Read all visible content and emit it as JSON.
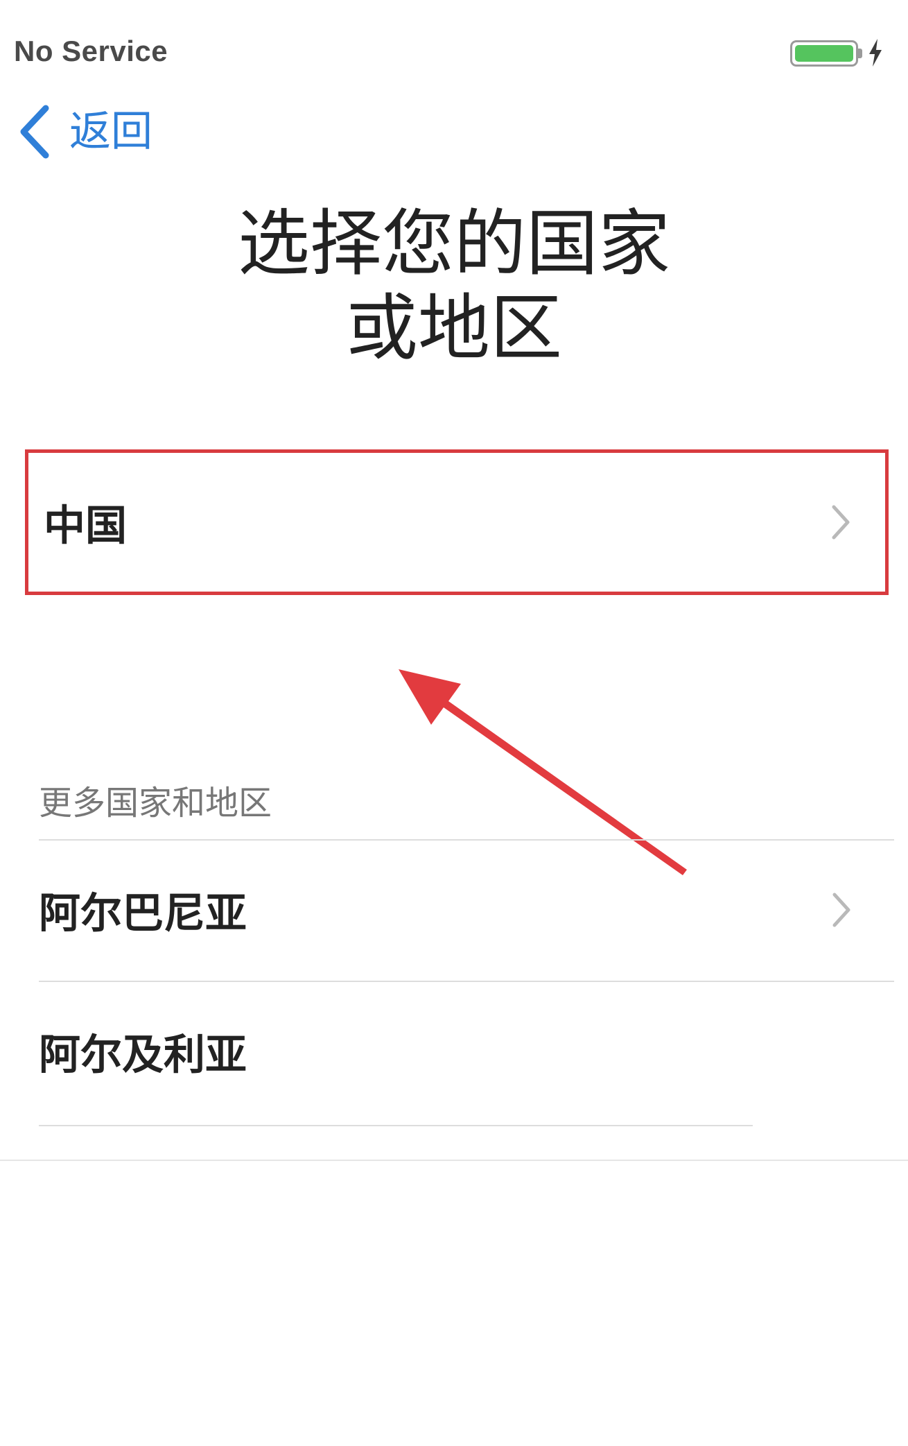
{
  "status_bar": {
    "carrier": "No Service",
    "battery_level": 1.0,
    "battery_color": "#55c45e",
    "charging": true,
    "charging_icon": "bolt-icon"
  },
  "nav": {
    "back_icon": "chevron-left-icon",
    "back_label": "返回",
    "accent_color": "#2f7fd8"
  },
  "title": {
    "line1": "选择您的国家",
    "line2": "或地区"
  },
  "selected_country": {
    "label": "中国",
    "chevron_icon": "chevron-right-icon",
    "highlight_color": "#d83b3f"
  },
  "annotation": {
    "type": "red-arrow",
    "color": "#e23b3f"
  },
  "more_section": {
    "header": "更多国家和地区",
    "items": [
      {
        "label": "阿尔巴尼亚",
        "chevron": true
      },
      {
        "label": "阿尔及利亚",
        "chevron": false
      }
    ]
  }
}
